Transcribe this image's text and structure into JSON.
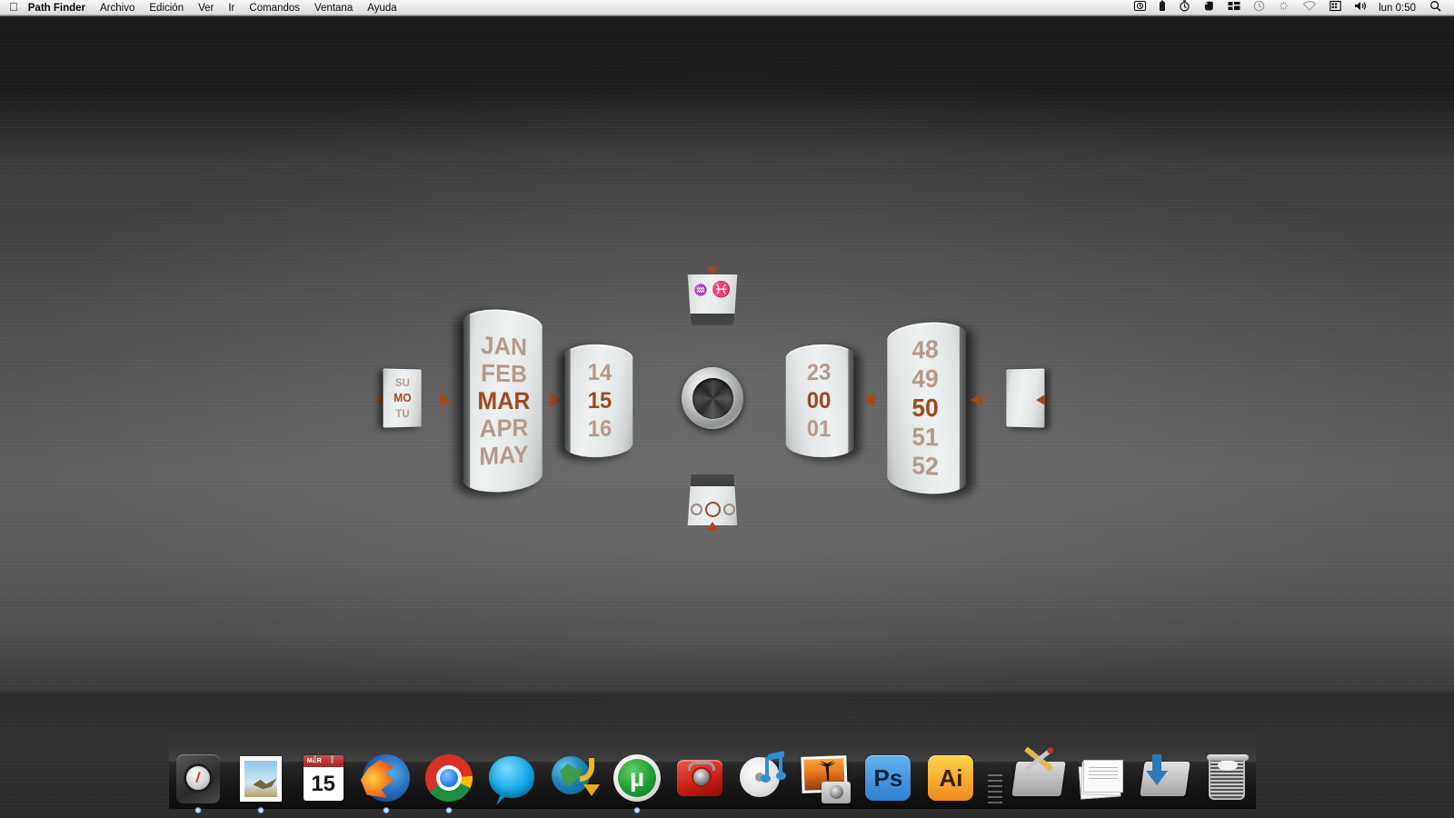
{
  "menubar": {
    "apple_icon": "apple-logo",
    "app_name": "Path Finder",
    "menus": [
      "Archivo",
      "Edición",
      "Ver",
      "Ir",
      "Comandos",
      "Ventana",
      "Ayuda"
    ],
    "status_icons": [
      "screen-sharing-icon",
      "battery-icon",
      "timer-icon",
      "evernote-icon",
      "app-switcher-icon",
      "time-machine-icon",
      "dropbox-icon",
      "airport-wifi-icon",
      "calendar-menu-icon",
      "volume-icon"
    ],
    "clock": "lun 0:50",
    "search_icon": "spotlight-search-icon"
  },
  "widget": {
    "name": "metal-rotary-clock-widget",
    "accent_color": "#9c4a1e",
    "dim_color": "#b59a8c",
    "weekday": {
      "label": "weekday-dial",
      "items": [
        "SU",
        "MO",
        "TU"
      ],
      "selected": "MO"
    },
    "month": {
      "label": "month-dial",
      "items": [
        "JAN",
        "FEB",
        "MAR",
        "APR",
        "MAY"
      ],
      "selected": "MAR"
    },
    "day": {
      "label": "day-dial",
      "items": [
        "14",
        "15",
        "16"
      ],
      "selected": "15"
    },
    "hour": {
      "label": "hour-dial",
      "items": [
        "23",
        "00",
        "01"
      ],
      "selected": "00"
    },
    "minute": {
      "label": "minute-dial",
      "items": [
        "48",
        "49",
        "50",
        "51",
        "52"
      ],
      "selected": "50"
    },
    "seconds": {
      "label": "seconds-dial",
      "value": ""
    },
    "zodiac": {
      "label": "zodiac-dial",
      "previous_glyph": "♒",
      "current_glyph": "♓",
      "selected": "Pisces"
    },
    "moon": {
      "label": "moon-phase-dial",
      "phases": [
        "waning",
        "current",
        "waxing"
      ]
    },
    "hub": {
      "label": "center-hub"
    }
  },
  "dock": {
    "items": [
      {
        "name": "path-finder",
        "icon": "compass-icon",
        "running": true
      },
      {
        "name": "mail",
        "icon": "stamp-icon",
        "running": true
      },
      {
        "name": "ical",
        "icon": "calendar-icon",
        "month": "MAR",
        "day": "15",
        "running": false
      },
      {
        "name": "firefox",
        "icon": "firefox-icon",
        "running": true
      },
      {
        "name": "google-chrome",
        "icon": "chrome-icon",
        "running": true
      },
      {
        "name": "adium",
        "icon": "chat-bubble-icon",
        "running": false
      },
      {
        "name": "download-manager",
        "icon": "globe-download-icon",
        "running": false
      },
      {
        "name": "utorrent",
        "icon": "utorrent-icon",
        "glyph": "µ",
        "running": true
      },
      {
        "name": "radio-player",
        "icon": "red-radio-icon",
        "running": false
      },
      {
        "name": "itunes",
        "icon": "itunes-cd-note-icon",
        "running": false
      },
      {
        "name": "iphoto",
        "icon": "photo-camera-icon",
        "running": false
      },
      {
        "name": "photoshop",
        "icon": "photoshop-icon",
        "glyph": "Ps",
        "running": false
      },
      {
        "name": "illustrator",
        "icon": "illustrator-icon",
        "glyph": "Ai",
        "running": false
      }
    ],
    "separator": "dock-separator",
    "stacks": [
      {
        "name": "applications-folder",
        "icon": "applications-folder-icon"
      },
      {
        "name": "documents-stack",
        "icon": "documents-stack-icon"
      },
      {
        "name": "downloads-folder",
        "icon": "downloads-folder-icon"
      },
      {
        "name": "trash",
        "icon": "trash-icon"
      }
    ]
  }
}
